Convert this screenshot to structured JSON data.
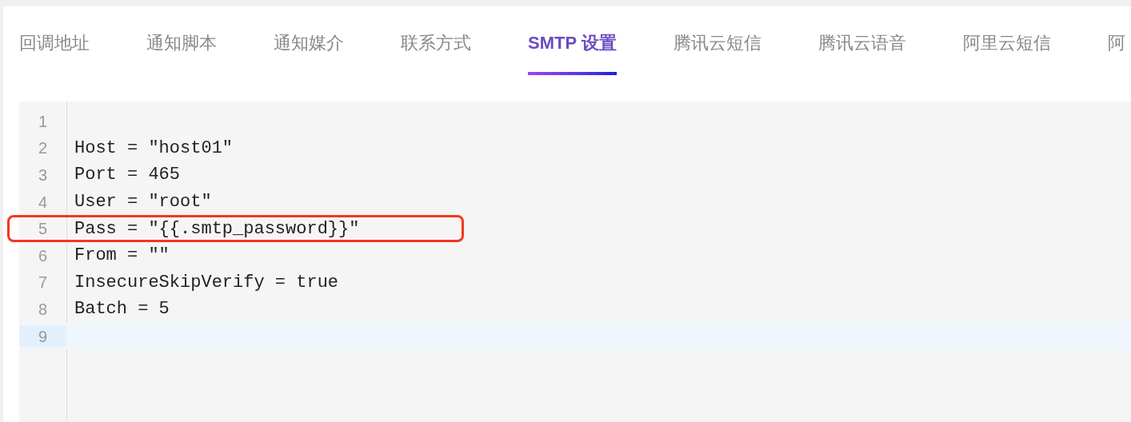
{
  "tabs": [
    {
      "label": "回调地址",
      "selected": false
    },
    {
      "label": "通知脚本",
      "selected": false
    },
    {
      "label": "通知媒介",
      "selected": false
    },
    {
      "label": "联系方式",
      "selected": false
    },
    {
      "label": "SMTP 设置",
      "selected": true
    },
    {
      "label": "腾讯云短信",
      "selected": false
    },
    {
      "label": "腾讯云语音",
      "selected": false
    },
    {
      "label": "阿里云短信",
      "selected": false
    },
    {
      "label": "阿",
      "selected": false
    }
  ],
  "editor": {
    "lines": [
      {
        "number": "1",
        "active": false,
        "highlighted": false
      },
      {
        "number": "2",
        "text": "Host = \"host01\"",
        "active": false,
        "highlighted": false
      },
      {
        "number": "3",
        "text": "Port = 465",
        "active": false,
        "highlighted": false
      },
      {
        "number": "4",
        "text": "User = \"root\"",
        "active": false,
        "highlighted": false
      },
      {
        "number": "5",
        "text": "Pass = \"{{.smtp_password}}\"",
        "active": false,
        "highlighted": true
      },
      {
        "number": "6",
        "text": "From = \"\"",
        "active": false,
        "highlighted": false
      },
      {
        "number": "7",
        "text": "InsecureSkipVerify = true",
        "active": false,
        "highlighted": false
      },
      {
        "number": "8",
        "text": "Batch = 5",
        "active": false,
        "highlighted": false
      },
      {
        "number": "9",
        "active": true,
        "highlighted": false
      }
    ]
  }
}
